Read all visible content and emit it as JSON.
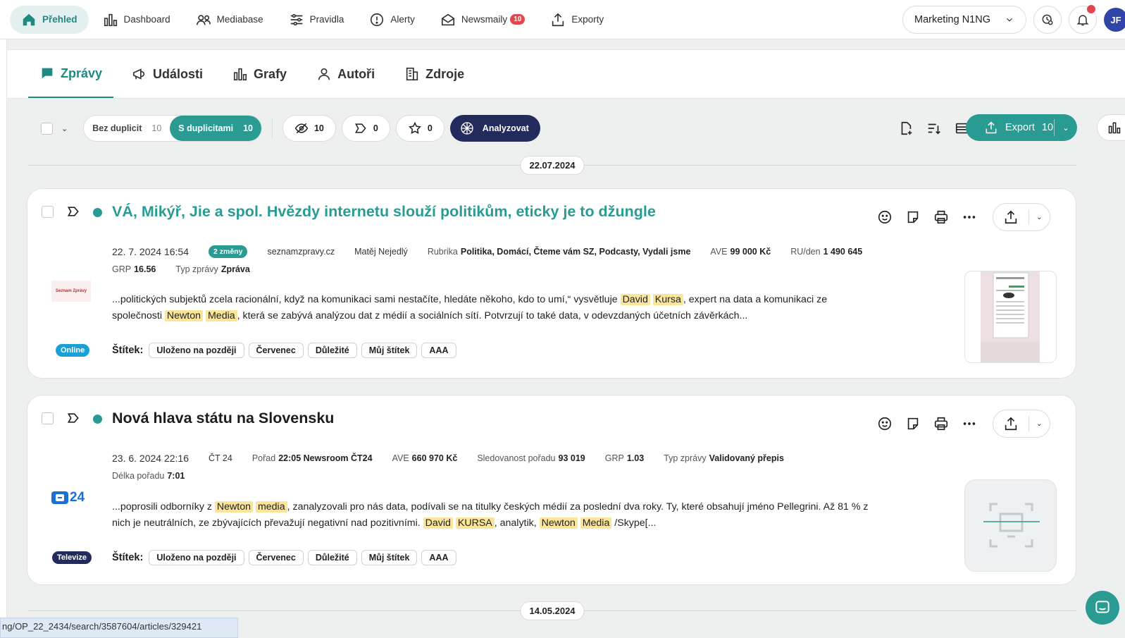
{
  "topnav": {
    "items": [
      {
        "label": "Přehled",
        "icon": "home-icon",
        "active": true
      },
      {
        "label": "Dashboard",
        "icon": "bar-chart-icon"
      },
      {
        "label": "Mediabase",
        "icon": "users-icon"
      },
      {
        "label": "Pravidla",
        "icon": "sliders-icon"
      },
      {
        "label": "Alerty",
        "icon": "alert-icon"
      },
      {
        "label": "Newsmaily",
        "icon": "mail-icon",
        "badge": "10"
      },
      {
        "label": "Exporty",
        "icon": "upload-icon"
      }
    ],
    "workspace": "Marketing N1NG",
    "avatar": "JF"
  },
  "tabs": [
    {
      "label": "Zprávy",
      "icon": "chat-icon",
      "active": true
    },
    {
      "label": "Události",
      "icon": "megaphone-icon"
    },
    {
      "label": "Grafy",
      "icon": "bar-chart-icon"
    },
    {
      "label": "Autoři",
      "icon": "person-icon"
    },
    {
      "label": "Zdroje",
      "icon": "building-icon"
    }
  ],
  "toolbar": {
    "dup_without": {
      "label": "Bez duplicit",
      "count": "10"
    },
    "dup_with": {
      "label": "S duplicitami",
      "count": "10"
    },
    "hidden_count": "10",
    "tagged_count": "0",
    "starred_count": "0",
    "analyze_label": "Analyzovat",
    "export_label": "Export",
    "export_count": "10"
  },
  "dates": [
    "22.07.2024",
    "14.05.2024"
  ],
  "articles": [
    {
      "title": "VÁ, Mikýř, Jie a spol. Hvězdy internetu slouží politikům, eticky je to džungle",
      "datetime": "22. 7. 2024 16:54",
      "changes": "2 změny",
      "source": "seznamzpravy.cz",
      "author": "Matěj Nejedlý",
      "rubric_label": "Rubrika",
      "rubric": "Politika, Domácí, Čteme vám SZ, Podcasty, Vydali jsme",
      "ave_label": "AVE",
      "ave": "99 000 Kč",
      "ru_label": "RU/den",
      "ru": "1 490 645",
      "grp_label": "GRP",
      "grp": "16.56",
      "type_label": "Typ zprávy",
      "type": "Zpráva",
      "excerpt_parts": [
        "...politických subjektů zcela racionální, když na komunikaci sami nestačíte, hledáte někoho, kdo to umí,“ vysvětluje ",
        "David",
        " ",
        "Kursa",
        ", expert na data a komunikaci ze společnosti ",
        "Newton",
        " ",
        "Media",
        ", která se zabývá analýzou dat z médií a sociálních sítí. Potvrzují to také data, v odevzdaných účetních závěrkách..."
      ],
      "logo_text": "Seznam Zprávy",
      "media_type": "Online",
      "labels_title": "Štítek:",
      "labels": [
        "Uloženo na později",
        "Červenec",
        "Důležité",
        "Můj štítek",
        "AAA"
      ]
    },
    {
      "title": "Nová hlava státu na Slovensku",
      "datetime": "23. 6. 2024 22:16",
      "source": "ČT 24",
      "show_label": "Pořad",
      "show": "22:05 Newsroom ČT24",
      "ave_label": "AVE",
      "ave": "660 970 Kč",
      "views_label": "Sledovanost pořadu",
      "views": "93 019",
      "grp_label": "GRP",
      "grp": "1.03",
      "type_label": "Typ zprávy",
      "type": "Validovaný přepis",
      "length_label": "Délka pořadu",
      "length": "7:01",
      "excerpt_parts": [
        "...poprosili odborníky z ",
        "Newton",
        " ",
        "media",
        ", zanalyzovali pro nás data, podívali se na titulky českých médií za poslední dva roky. Ty, které obsahují jméno Pellegrini. Až 81 % z nich je neutrálních, ze zbývajících převažují negativní nad pozitivními. ",
        "David",
        " ",
        "KURSA",
        ", analytik, ",
        "Newton",
        " ",
        "Media",
        " /Skype[..."
      ],
      "logo_text": "24",
      "media_type": "Televize",
      "labels_title": "Štítek:",
      "labels": [
        "Uloženo na později",
        "Červenec",
        "Důležité",
        "Můj štítek",
        "AAA"
      ]
    }
  ],
  "status_url": "ng/OP_22_2434/search/3587604/articles/329421",
  "colors": {
    "teal": "#2a9b93",
    "navy": "#232a5c",
    "online_badge": "#1aa0d8",
    "tv_badge": "#232a5c",
    "highlight": "#fbe59a"
  }
}
